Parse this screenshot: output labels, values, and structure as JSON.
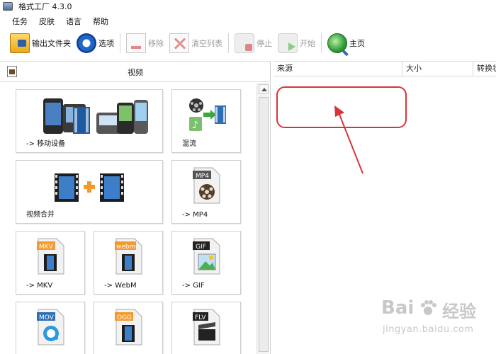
{
  "window": {
    "title": "格式工厂 4.3.0"
  },
  "menu": {
    "items": [
      "任务",
      "皮肤",
      "语言",
      "帮助"
    ]
  },
  "toolbar": {
    "output_folder": "输出文件夹",
    "options": "选项",
    "remove": "移除",
    "clear_list": "清空列表",
    "stop": "停止",
    "start": "开始",
    "home": "主页"
  },
  "left_panel": {
    "header": "视频",
    "tiles": [
      {
        "label": "-> 移动设备"
      },
      {
        "label": "混流"
      },
      {
        "label": "视频合并"
      },
      {
        "label": "-> MP4"
      },
      {
        "label": "-> MKV"
      },
      {
        "label": "-> WebM"
      },
      {
        "label": "-> GIF"
      },
      {
        "label": ""
      },
      {
        "label": ""
      },
      {
        "label": ""
      }
    ],
    "file_badges": {
      "mp4": "MP4",
      "mkv": "MKV",
      "webm": "webm",
      "gif": "GIF",
      "mov": "MOV",
      "ogg": "OGG",
      "flv": "FLV"
    }
  },
  "right_panel": {
    "columns": [
      "来源",
      "大小",
      "转换状态"
    ]
  },
  "watermark": {
    "logo_left": "Bai",
    "logo_right": "经验",
    "url": "jingyan.baidu.com"
  },
  "colors": {
    "annotation": "#d9343a",
    "film_blue": "#2b6fb6",
    "accent_orange": "#f29a2e"
  }
}
